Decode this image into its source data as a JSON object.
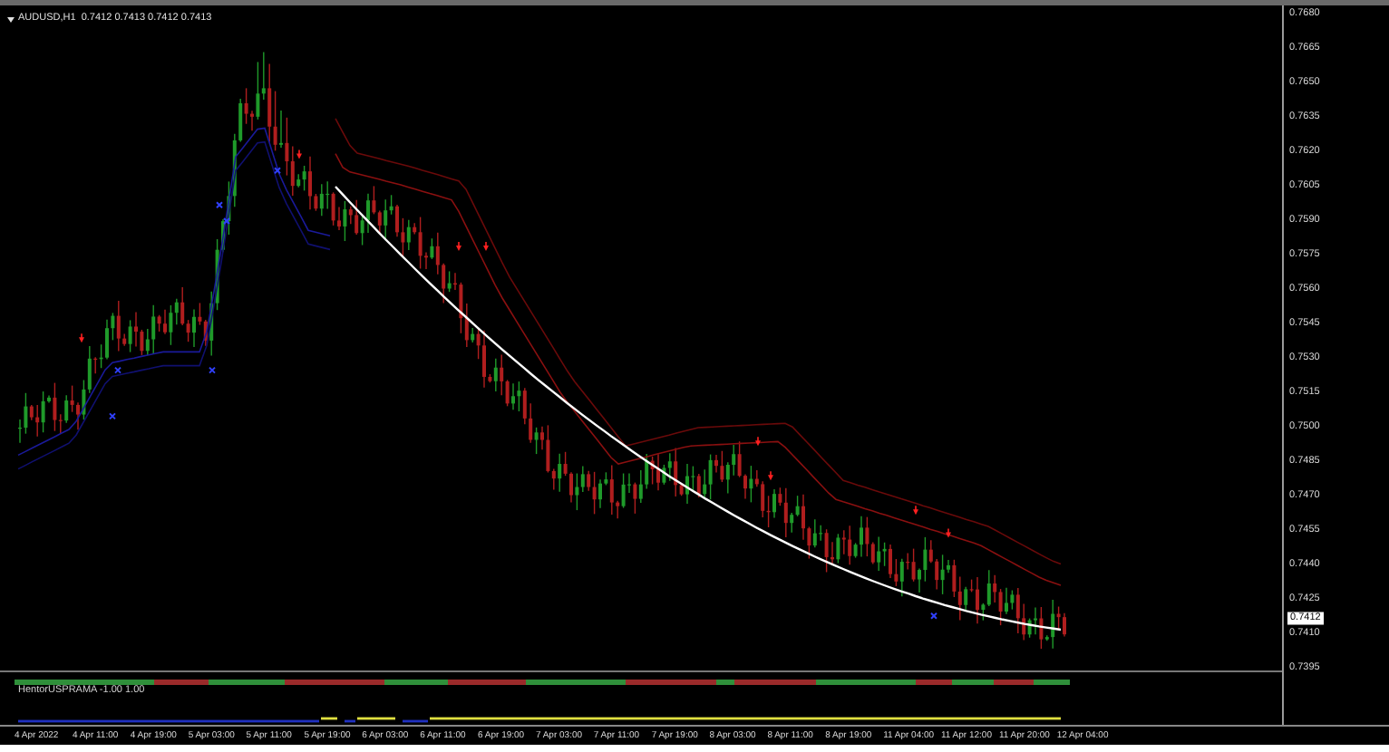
{
  "chart": {
    "title": "AUDUSD,H1  0.7412 0.7413 0.7412 0.7413"
  },
  "price_axis": {
    "labels": [
      "0.7680",
      "0.7665",
      "0.7650",
      "0.7635",
      "0.7620",
      "0.7605",
      "0.7590",
      "0.7575",
      "0.7560",
      "0.7545",
      "0.7530",
      "0.7515",
      "0.7500",
      "0.7485",
      "0.7470",
      "0.7455",
      "0.7440",
      "0.7425",
      "0.7410",
      "0.7395"
    ],
    "current_price": "0.7412"
  },
  "indicator": {
    "label": "HentorUSPRAMA -1.00 1.00"
  },
  "time_axis": {
    "labels": [
      "4 Apr 2022",
      "4 Apr 11:00",
      "4 Apr 19:00",
      "5 Apr 03:00",
      "5 Apr 11:00",
      "5 Apr 19:00",
      "6 Apr 03:00",
      "6 Apr 11:00",
      "6 Apr 19:00",
      "7 Apr 03:00",
      "7 Apr 11:00",
      "7 Apr 19:00",
      "8 Apr 03:00",
      "8 Apr 11:00",
      "8 Apr 19:00",
      "11 Apr 04:00",
      "11 Apr 12:00",
      "11 Apr 20:00",
      "12 Apr 04:00"
    ]
  }
}
